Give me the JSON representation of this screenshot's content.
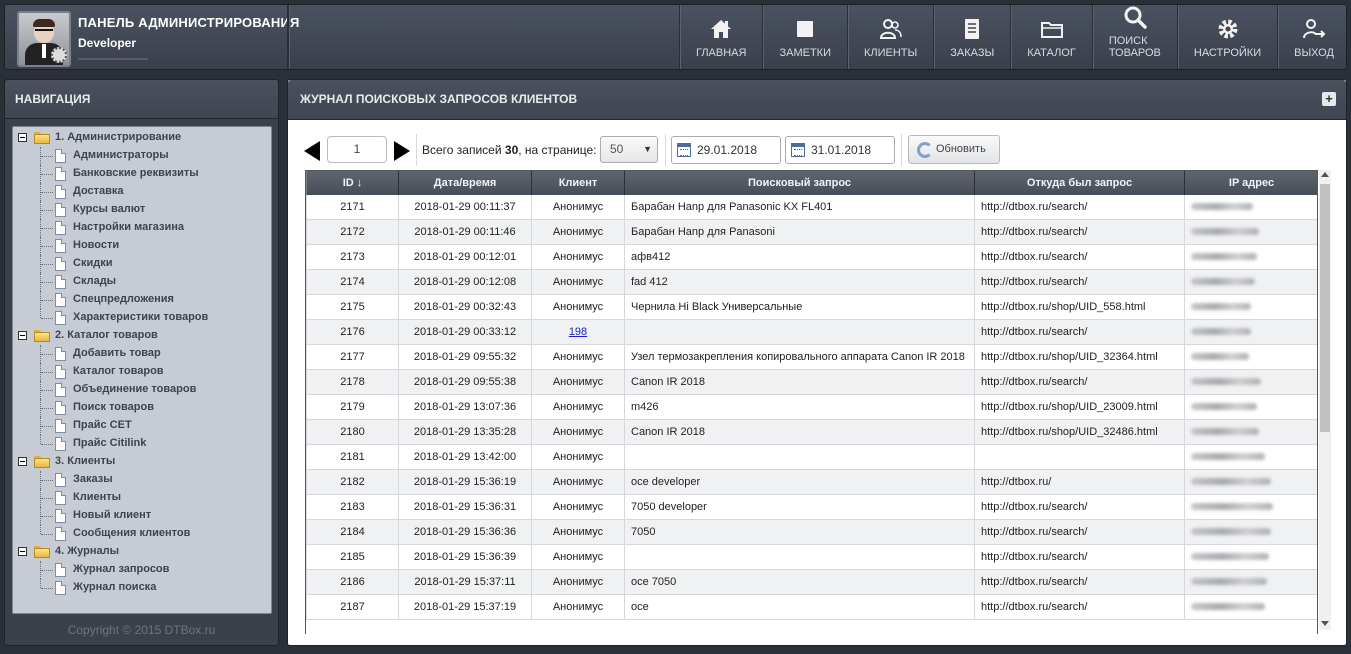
{
  "header": {
    "title": "ПАНЕЛЬ АДМИНИСТРИРОВАНИЯ",
    "user": "Developer"
  },
  "nav": [
    {
      "label": "ГЛАВНАЯ",
      "icon": "home-icon"
    },
    {
      "label": "ЗАМЕТКИ",
      "icon": "note-icon"
    },
    {
      "label": "КЛИЕНТЫ",
      "icon": "users-icon"
    },
    {
      "label": "ЗАКАЗЫ",
      "icon": "document-icon"
    },
    {
      "label": "КАТАЛОГ",
      "icon": "folder-icon"
    },
    {
      "label": "ПОИСК ТОВАРОВ",
      "icon": "search-icon"
    },
    {
      "label": "НАСТРОЙКИ",
      "icon": "gear-icon"
    },
    {
      "label": "ВЫХОД",
      "icon": "logout-icon"
    }
  ],
  "sidebar": {
    "title": "НАВИГАЦИЯ",
    "groups": [
      {
        "label": "1. Администрирование",
        "items": [
          "Администраторы",
          "Банковские реквизиты",
          "Доставка",
          "Курсы валют",
          "Настройки магазина",
          "Новости",
          "Скидки",
          "Склады",
          "Спецпредложения",
          "Характеристики товаров"
        ]
      },
      {
        "label": "2. Каталог товаров",
        "items": [
          "Добавить товар",
          "Каталог товаров",
          "Объединение товаров",
          "Поиск товаров",
          "Прайс CET",
          "Прайс Citilink"
        ]
      },
      {
        "label": "3. Клиенты",
        "items": [
          "Заказы",
          "Клиенты",
          "Новый клиент",
          "Сообщения клиентов"
        ]
      },
      {
        "label": "4. Журналы",
        "items": [
          "Журнал запросов",
          "Журнал поиска"
        ]
      }
    ],
    "copyright": "Copyright © 2015 DTBox.ru"
  },
  "main": {
    "title": "ЖУРНАЛ ПОИСКОВЫХ ЗАПРОСОВ КЛИЕНТОВ",
    "plus": "+",
    "toolbar": {
      "page": "1",
      "total_prefix": "Всего записей ",
      "total_count": "30",
      "total_suffix": ", на странице:",
      "per_page": "50",
      "dropdown_arrow": "▼",
      "date_from": "29.01.2018",
      "date_to": "31.01.2018",
      "refresh": "Обновить"
    },
    "columns": [
      "ID ↓",
      "Дата/время",
      "Клиент",
      "Поисковый запрос",
      "Откуда был запрос",
      "IP адрес"
    ],
    "rows": [
      {
        "id": "2171",
        "dt": "2018-01-29 00:11:37",
        "client": "Анонимус",
        "query": "Барабан Hanp для Panasonic KX FL401",
        "from": "http://dtbox.ru/search/"
      },
      {
        "id": "2172",
        "dt": "2018-01-29 00:11:46",
        "client": "Анонимус",
        "query": "Барабан Hanp для Panasoni",
        "from": "http://dtbox.ru/search/"
      },
      {
        "id": "2173",
        "dt": "2018-01-29 00:12:01",
        "client": "Анонимус",
        "query": "афв412",
        "from": "http://dtbox.ru/search/"
      },
      {
        "id": "2174",
        "dt": "2018-01-29 00:12:08",
        "client": "Анонимус",
        "query": "fad 412",
        "from": "http://dtbox.ru/search/"
      },
      {
        "id": "2175",
        "dt": "2018-01-29 00:32:43",
        "client": "Анонимус",
        "query": "Чернила Hi Black Универсальные",
        "from": "http://dtbox.ru/shop/UID_558.html"
      },
      {
        "id": "2176",
        "dt": "2018-01-29 00:33:12",
        "client": "198",
        "client_link": true,
        "query": "",
        "from": "http://dtbox.ru/search/"
      },
      {
        "id": "2177",
        "dt": "2018-01-29 09:55:32",
        "client": "Анонимус",
        "query": "Узел термозакрепления копировального аппарата Canon IR 2018",
        "from": "http://dtbox.ru/shop/UID_32364.html"
      },
      {
        "id": "2178",
        "dt": "2018-01-29 09:55:38",
        "client": "Анонимус",
        "query": "Canon IR 2018",
        "from": "http://dtbox.ru/search/"
      },
      {
        "id": "2179",
        "dt": "2018-01-29 13:07:36",
        "client": "Анонимус",
        "query": "m426",
        "from": "http://dtbox.ru/shop/UID_23009.html"
      },
      {
        "id": "2180",
        "dt": "2018-01-29 13:35:28",
        "client": "Анонимус",
        "query": "Canon IR 2018",
        "from": "http://dtbox.ru/shop/UID_32486.html"
      },
      {
        "id": "2181",
        "dt": "2018-01-29 13:42:00",
        "client": "Анонимус",
        "query": "",
        "from": ""
      },
      {
        "id": "2182",
        "dt": "2018-01-29 15:36:19",
        "client": "Анонимус",
        "query": "oce developer",
        "from": "http://dtbox.ru/"
      },
      {
        "id": "2183",
        "dt": "2018-01-29 15:36:31",
        "client": "Анонимус",
        "query": "7050 developer",
        "from": "http://dtbox.ru/search/"
      },
      {
        "id": "2184",
        "dt": "2018-01-29 15:36:36",
        "client": "Анонимус",
        "query": "7050",
        "from": "http://dtbox.ru/search/"
      },
      {
        "id": "2185",
        "dt": "2018-01-29 15:36:39",
        "client": "Анонимус",
        "query": "",
        "from": "http://dtbox.ru/search/"
      },
      {
        "id": "2186",
        "dt": "2018-01-29 15:37:11",
        "client": "Анонимус",
        "query": "oce 7050",
        "from": "http://dtbox.ru/search/"
      },
      {
        "id": "2187",
        "dt": "2018-01-29 15:37:19",
        "client": "Анонимус",
        "query": "oce",
        "from": "http://dtbox.ru/search/"
      }
    ]
  }
}
